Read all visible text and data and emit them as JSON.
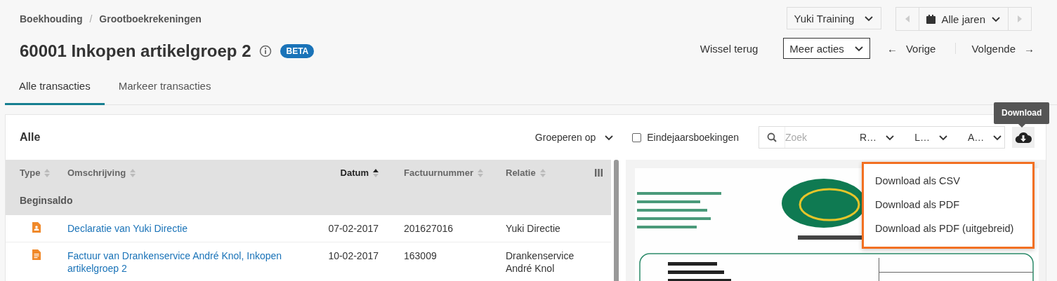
{
  "breadcrumb": {
    "items": [
      "Boekhouding",
      "Grootboekrekeningen"
    ],
    "separator": "/"
  },
  "title": "60001 Inkopen artikelgroep 2",
  "badge": "BETA",
  "company_select": {
    "value": "Yuki Training"
  },
  "year_picker": {
    "value": "Alle jaren",
    "previous_disabled": true,
    "next_disabled": true
  },
  "actions": {
    "switch_back": "Wissel terug",
    "more_actions": "Meer acties",
    "previous": {
      "arrow": "←",
      "label": "Vorige"
    },
    "next": {
      "label": "Volgende",
      "arrow": "→"
    }
  },
  "tabs": [
    {
      "label": "Alle transacties",
      "selected": true
    },
    {
      "label": "Markeer transacties",
      "selected": false
    }
  ],
  "panel": {
    "title": "Alle",
    "group_by": "Groeperen op",
    "year_end_checkbox": {
      "label": "Eindejaarsboekingen",
      "checked": false
    },
    "search": {
      "placeholder": "Zoek"
    },
    "filters": [
      "R…",
      "L…",
      "A…"
    ],
    "download_tooltip": "Download",
    "download_menu": [
      "Download als CSV",
      "Download als PDF",
      "Download als PDF (uitgebreid)"
    ]
  },
  "table": {
    "columns": [
      {
        "label": "Type",
        "sorted": false
      },
      {
        "label": "Omschrijving",
        "sorted": false
      },
      {
        "label": "Datum",
        "sorted": true
      },
      {
        "label": "Factuurnummer",
        "sorted": false
      },
      {
        "label": "Relatie",
        "sorted": false
      }
    ],
    "group_row": "Beginsaldo",
    "rows": [
      {
        "kind": "declaration",
        "description": "Declaratie van Yuki Directie",
        "date": "07-02-2017",
        "invoice_number": "201627016",
        "relation": "Yuki Directie"
      },
      {
        "kind": "invoice",
        "description": "Factuur van Drankenservice André Knol, Inkopen artikelgroep 2",
        "date": "10-02-2017",
        "invoice_number": "163009",
        "relation": "Drankenservice André Knol"
      }
    ]
  }
}
